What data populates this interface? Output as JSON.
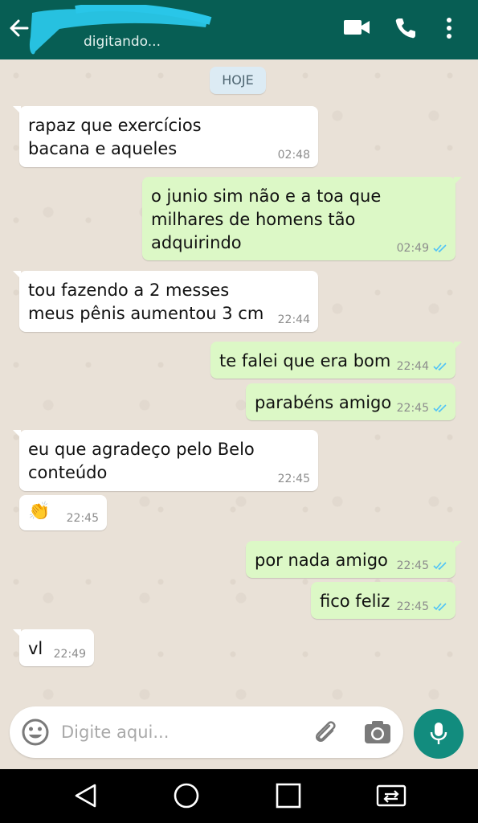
{
  "header": {
    "status": "digitando...",
    "icons": [
      "back-arrow-icon",
      "video-call-icon",
      "phone-icon",
      "more-vert-icon"
    ],
    "color": "#075e54"
  },
  "date_label": "HOJE",
  "messages": [
    {
      "dir": "in",
      "text": "rapaz que exercícios\nbacana e aqueles",
      "time": "02:48"
    },
    {
      "dir": "out",
      "text": "o junio sim não e a toa que\nmilhares de homens tão\nadquirindo",
      "time": "02:49",
      "read": true
    },
    {
      "dir": "in",
      "text": "tou fazendo a 2 messes\nmeus pênis aumentou 3 cm",
      "time": "22:44"
    },
    {
      "dir": "out",
      "text": "te falei que era bom",
      "time": "22:44",
      "read": true
    },
    {
      "dir": "out",
      "text": "parabéns amigo",
      "time": "22:45",
      "read": true
    },
    {
      "dir": "in",
      "text": "eu que agradeço pelo Belo\nconteúdo",
      "time": "22:45"
    },
    {
      "dir": "in",
      "text": "👏",
      "time": "22:45"
    },
    {
      "dir": "out",
      "text": "por nada amigo",
      "time": "22:45",
      "read": true
    },
    {
      "dir": "out",
      "text": "fico feliz",
      "time": "22:45",
      "read": true
    },
    {
      "dir": "in",
      "text": "vl",
      "time": "22:49"
    }
  ],
  "input": {
    "placeholder": "Digite aqui...",
    "icons": [
      "emoji-icon",
      "attach-icon",
      "camera-icon",
      "mic-icon"
    ]
  },
  "colors": {
    "incoming": "#ffffff",
    "outgoing": "#dcf8c6",
    "read_ticks": "#4fc3f7",
    "mic_button": "#128c7e"
  }
}
